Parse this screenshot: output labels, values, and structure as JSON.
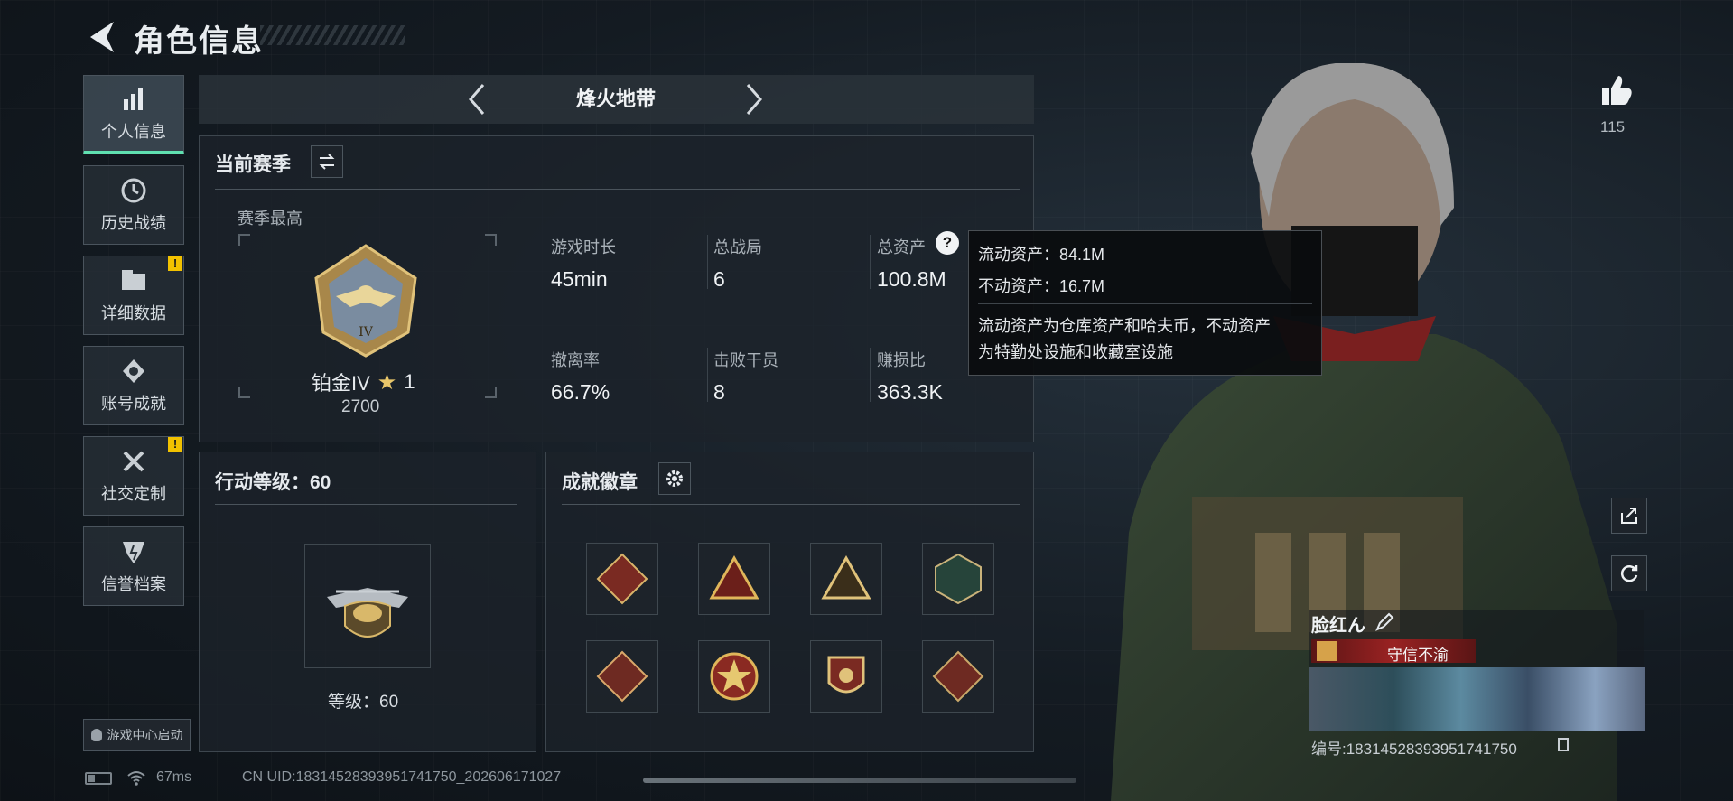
{
  "header": {
    "title": "角色信息"
  },
  "sidebar": {
    "items": [
      {
        "label": "个人信息",
        "icon": "bar-chart-icon",
        "active": true
      },
      {
        "label": "历史战绩",
        "icon": "clock-icon"
      },
      {
        "label": "详细数据",
        "icon": "folder-icon",
        "warning": "!"
      },
      {
        "label": "账号成就",
        "icon": "medal-icon"
      },
      {
        "label": "社交定制",
        "icon": "tools-icon",
        "warning": "!"
      },
      {
        "label": "信誉档案",
        "icon": "shield-icon"
      }
    ],
    "launch_label": "游戏中心启动"
  },
  "mode_tabs": {
    "current": "烽火地带"
  },
  "season": {
    "title": "当前赛季",
    "best_label": "赛季最高",
    "rank": "铂金IV",
    "stars": "1",
    "score": "2700",
    "stats": [
      {
        "label": "游戏时长",
        "value": "45min"
      },
      {
        "label": "总战局",
        "value": "6"
      },
      {
        "label": "总资产",
        "value": "100.8M"
      },
      {
        "label": "撤离率",
        "value": "66.7%"
      },
      {
        "label": "击败干员",
        "value": "8"
      },
      {
        "label": "赚损比",
        "value": "363.3K"
      }
    ]
  },
  "tooltip": {
    "liquid": "流动资产：84.1M",
    "fixed": "不动资产：16.7M",
    "desc_line1": "流动资产为仓库资产和哈夫币，不动资产",
    "desc_line2": "为特勤处设施和收藏室设施"
  },
  "action_level": {
    "title": "行动等级：60",
    "level_label": "等级：60"
  },
  "achievements": {
    "title": "成就徽章",
    "badge_count": 8
  },
  "profile": {
    "likes": "115",
    "name": "脸红ん",
    "honor": "守信不渝",
    "id_text": "编号:18314528393951741750"
  },
  "footer": {
    "ping": "67ms",
    "uid": "CN UID:18314528393951741750_202606171027"
  },
  "colors": {
    "accent": "#5fe0b0",
    "warning": "#f2c200",
    "honor_bg": "#8a1d1d"
  }
}
